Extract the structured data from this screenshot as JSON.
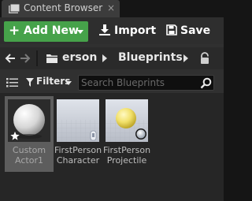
{
  "window": {
    "tab_title": "Content Browser",
    "tab_close": "×"
  },
  "toolbar": {
    "add_new_label": "Add New",
    "import_label": "Import",
    "save_label": "Save"
  },
  "navigation": {
    "breadcrumbs": [
      "erson",
      "Blueprints"
    ]
  },
  "filter": {
    "filters_label": "Filters",
    "search_placeholder": "Search Blueprints",
    "search_value": ""
  },
  "assets": [
    {
      "name_line1": "Custom",
      "name_line2": "Actor1",
      "selected": true,
      "thumbnail": "white-sphere",
      "type_icon": "star-icon"
    },
    {
      "name_line1": "FirstPerson",
      "name_line2": "Character",
      "selected": false,
      "thumbnail": "empty-grid",
      "type_icon": "character-icon"
    },
    {
      "name_line1": "FirstPerson",
      "name_line2": "Projectile",
      "selected": false,
      "thumbnail": "yellow-sphere",
      "type_icon": "sphere-badge-icon"
    }
  ],
  "colors": {
    "add_new_button": "#46a24a",
    "panel_background": "#303030",
    "asset_area": "#262626",
    "selection": "#5d5d5d"
  }
}
